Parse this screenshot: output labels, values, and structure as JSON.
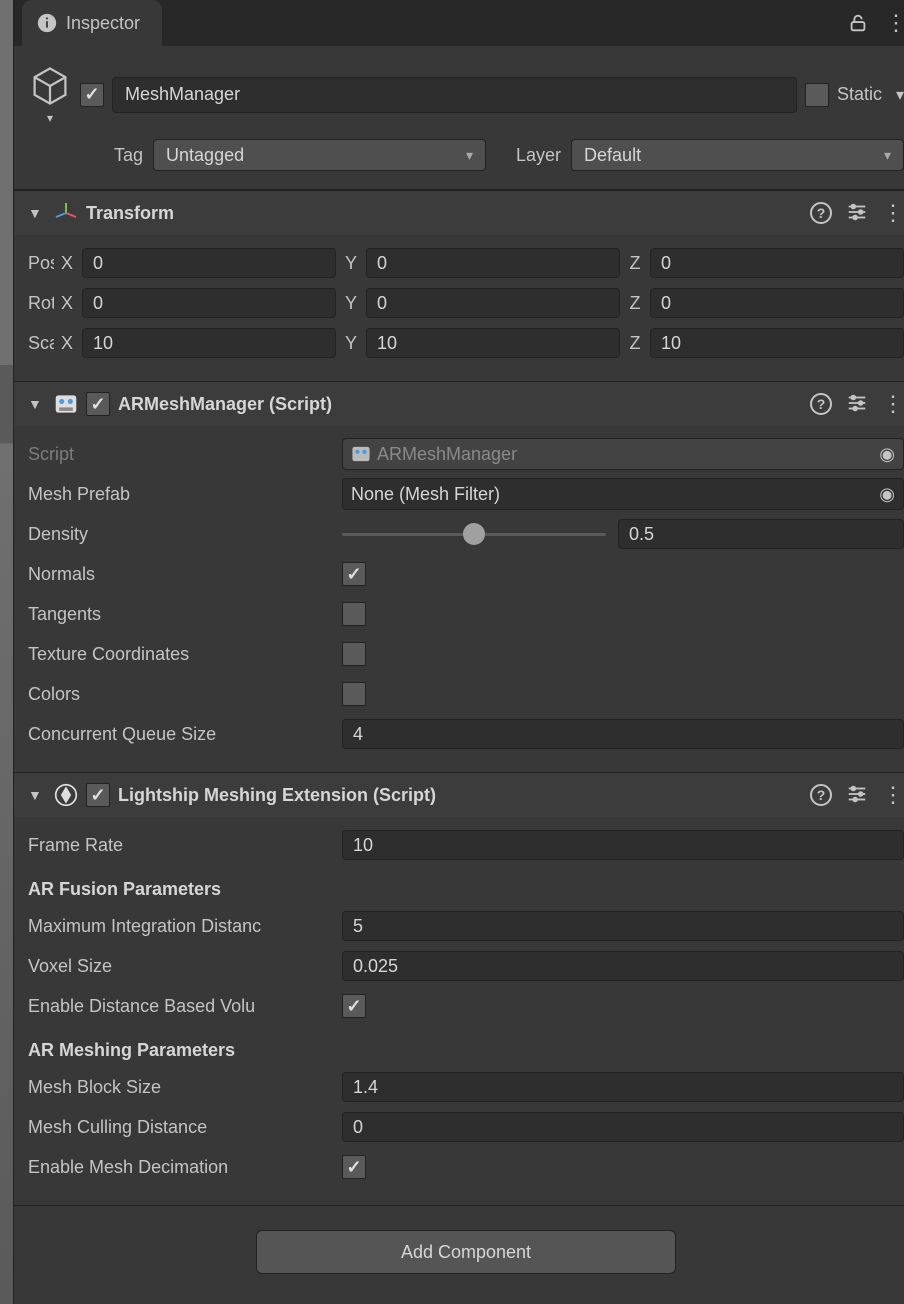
{
  "tab": {
    "title": "Inspector"
  },
  "header": {
    "enabled": true,
    "name": "MeshManager",
    "static_checked": false,
    "static_label": "Static",
    "tag_label": "Tag",
    "tag_value": "Untagged",
    "layer_label": "Layer",
    "layer_value": "Default"
  },
  "transform": {
    "title": "Transform",
    "position_label": "Position",
    "rotation_label": "Rotation",
    "scale_label": "Scale",
    "position": {
      "x": "0",
      "y": "0",
      "z": "0"
    },
    "rotation": {
      "x": "0",
      "y": "0",
      "z": "0"
    },
    "scale": {
      "x": "10",
      "y": "10",
      "z": "10"
    }
  },
  "armesh": {
    "enabled": true,
    "title": "ARMeshManager (Script)",
    "script_label": "Script",
    "script_value": "ARMeshManager",
    "prefab_label": "Mesh Prefab",
    "prefab_value": "None (Mesh Filter)",
    "density_label": "Density",
    "density_value": "0.5",
    "density_pct": 50,
    "normals_label": "Normals",
    "normals_checked": true,
    "tangents_label": "Tangents",
    "tangents_checked": false,
    "texcoords_label": "Texture Coordinates",
    "texcoords_checked": false,
    "colors_label": "Colors",
    "colors_checked": false,
    "queue_label": "Concurrent Queue Size",
    "queue_value": "4"
  },
  "lightship": {
    "enabled": true,
    "title": "Lightship Meshing Extension (Script)",
    "frame_rate_label": "Frame Rate",
    "frame_rate_value": "10",
    "fusion_header": "AR Fusion Parameters",
    "max_int_label": "Maximum Integration Distanc",
    "max_int_value": "5",
    "voxel_label": "Voxel Size",
    "voxel_value": "0.025",
    "dist_vol_label": "Enable Distance Based Volu",
    "dist_vol_checked": true,
    "meshing_header": "AR Meshing Parameters",
    "block_label": "Mesh Block Size",
    "block_value": "1.4",
    "cull_label": "Mesh Culling Distance",
    "cull_value": "0",
    "decim_label": "Enable Mesh Decimation",
    "decim_checked": true
  },
  "add_component_label": "Add Component"
}
